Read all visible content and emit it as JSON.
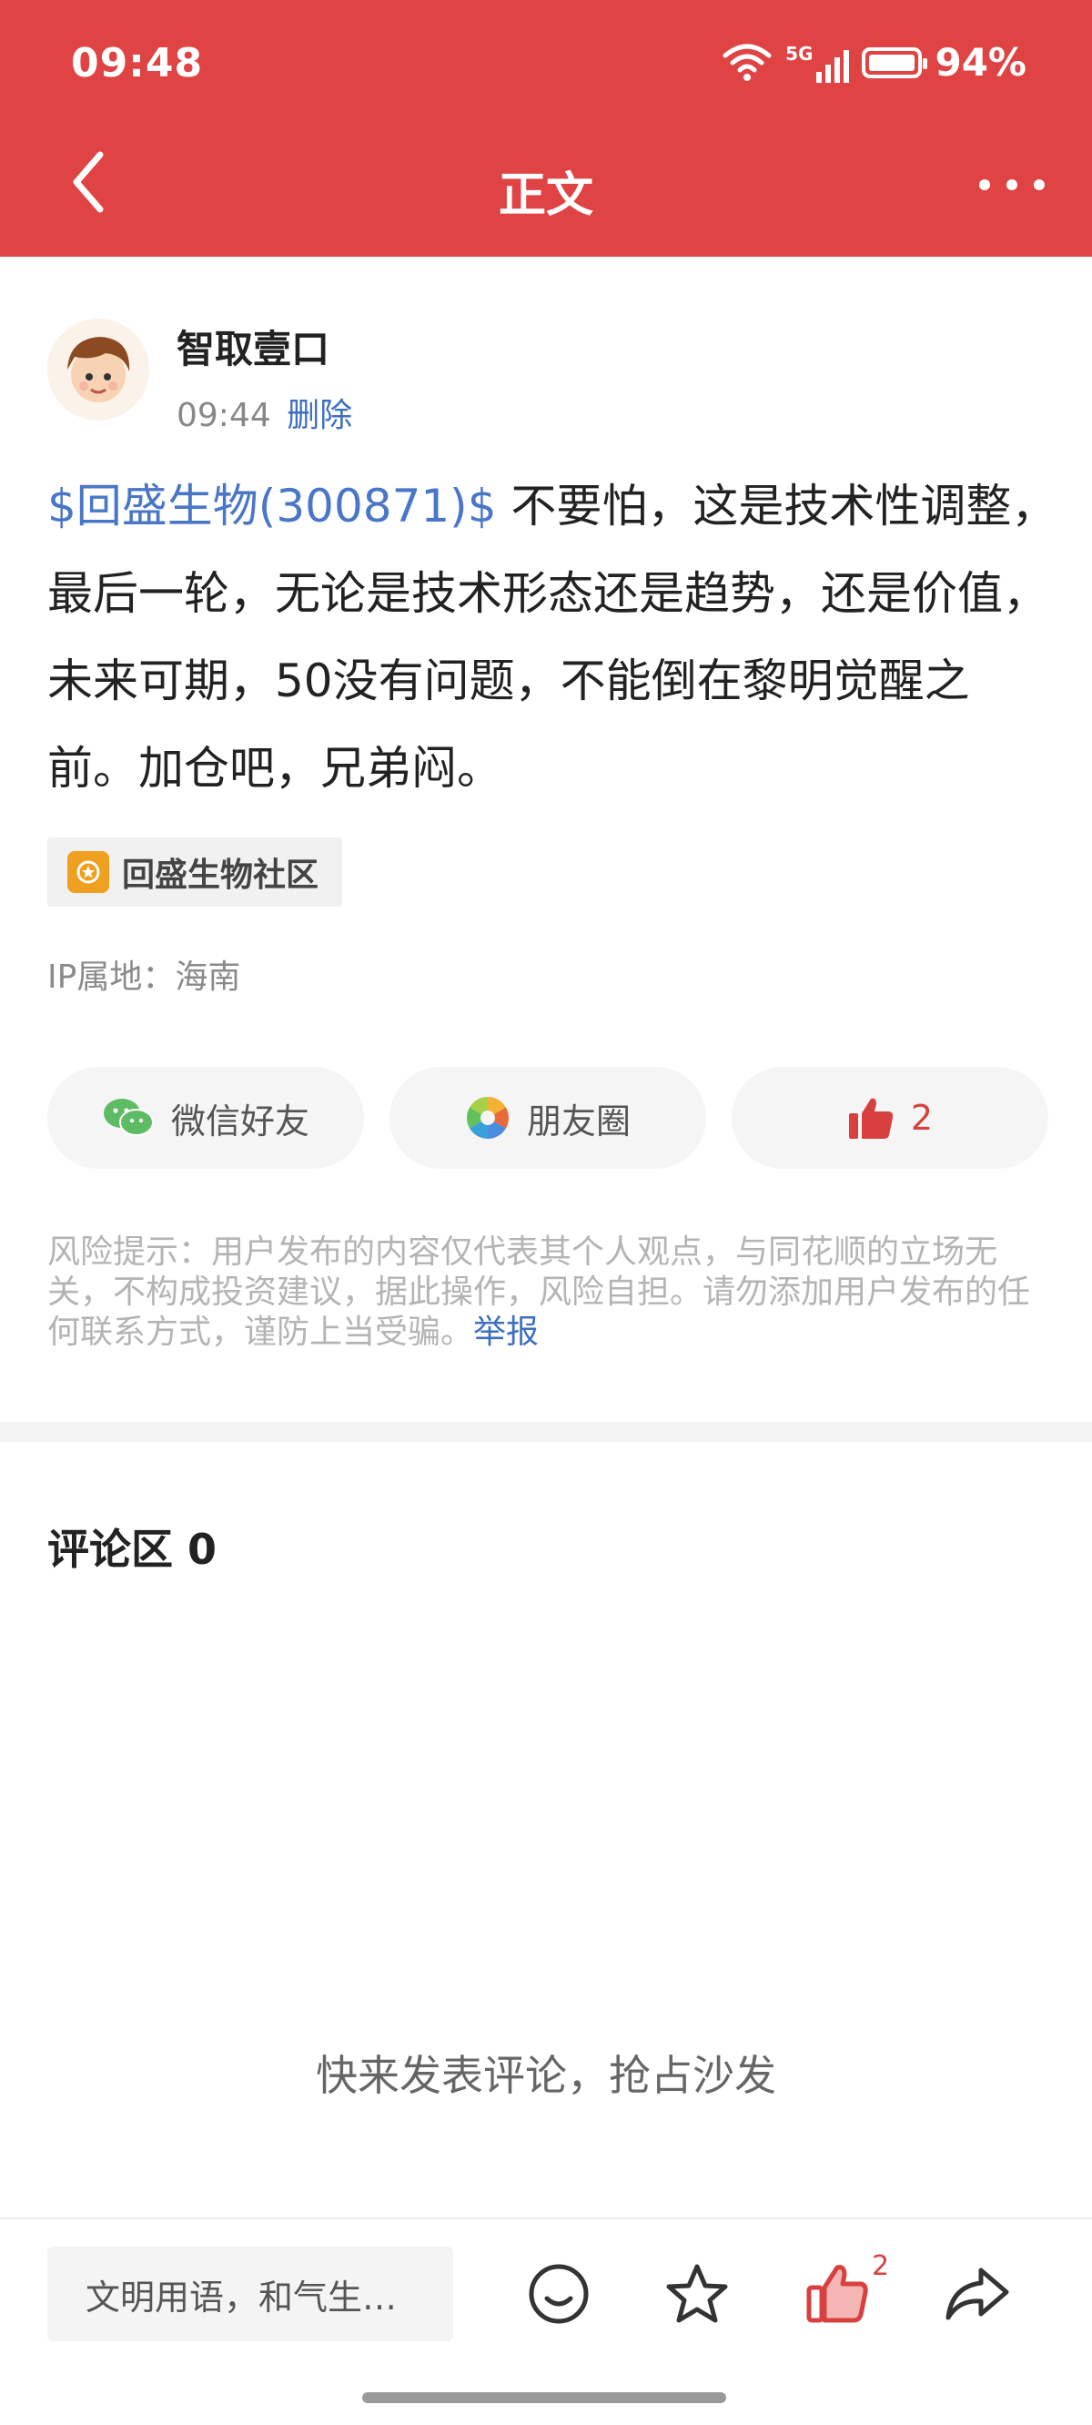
{
  "status_bar": {
    "time": "09:48",
    "battery": "94%",
    "network": "5G"
  },
  "nav": {
    "title": "正文"
  },
  "author": {
    "name": "智取壹口",
    "time": "09:44",
    "delete_label": "删除"
  },
  "post": {
    "stock_tag": "$回盛生物(300871)$",
    "text": " 不要怕，这是技术性调整，最后一轮，无论是技术形态还是趋势，还是价值，未来可期，50没有问题，不能倒在黎明觉醒之前。加仓吧，兄弟闷。"
  },
  "community": {
    "label": "回盛生物社区"
  },
  "ip": {
    "text": "IP属地：海南"
  },
  "share": {
    "wechat": "微信好友",
    "moments": "朋友圈",
    "like_count": "2"
  },
  "risk": {
    "text": "风险提示：用户发布的内容仅代表其个人观点，与同花顺的立场无关，不构成投资建议，据此操作，风险自担。请勿添加用户发布的任何联系方式，谨防上当受骗。",
    "report_label": "举报"
  },
  "comments": {
    "title": "评论区 0",
    "empty_text": "快来发表评论，抢占沙发"
  },
  "bottom_bar": {
    "input_placeholder": "文明用语，和气生…",
    "like_count": "2"
  },
  "colors": {
    "header": "#e04343",
    "link": "#3e6fc0",
    "like": "#d84040"
  },
  "icons": [
    "back-icon",
    "more-icon",
    "wechat-icon",
    "moments-icon",
    "thumb-up-icon",
    "emoji-icon",
    "star-icon",
    "share-icon"
  ]
}
